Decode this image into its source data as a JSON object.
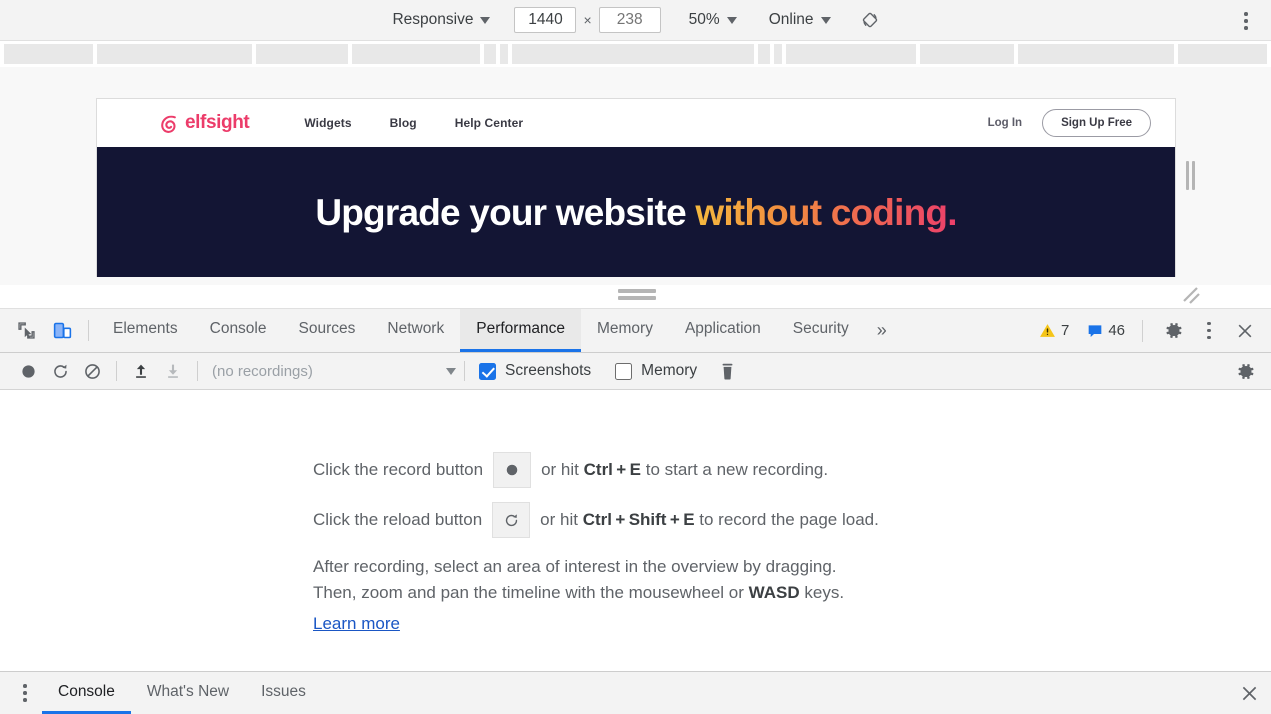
{
  "device_toolbar": {
    "device_preset": "Responsive",
    "width_value": "1440",
    "height_placeholder": "238",
    "times_symbol": "×",
    "zoom": "50%",
    "throttling": "Online",
    "rotate_icon": "rotate-icon",
    "more_options_icon": "more-vertical-icon"
  },
  "page_preview": {
    "logo_text": "elfsight",
    "nav_links": [
      "Widgets",
      "Blog",
      "Help Center"
    ],
    "login_label": "Log In",
    "signup_label": "Sign Up Free",
    "hero_text_plain": "Upgrade your website ",
    "hero_text_highlight": "without coding.",
    "colors": {
      "brand_pink": "#ec3c6a",
      "hero_bg": "#131534",
      "gradient_start": "#f5b93f",
      "gradient_end": "#ec3f6b"
    }
  },
  "devtools": {
    "inspect_icon": "inspect-cursor-icon",
    "device_toggle_icon": "device-toolbar-icon",
    "tabs": [
      {
        "label": "Elements",
        "active": false
      },
      {
        "label": "Console",
        "active": false
      },
      {
        "label": "Sources",
        "active": false
      },
      {
        "label": "Network",
        "active": false
      },
      {
        "label": "Performance",
        "active": true
      },
      {
        "label": "Memory",
        "active": false
      },
      {
        "label": "Application",
        "active": false
      },
      {
        "label": "Security",
        "active": false
      }
    ],
    "overflow_label": "»",
    "warning_count": "7",
    "warning_icon": "warning-triangle-icon",
    "message_count": "46",
    "message_icon": "message-icon",
    "settings_icon": "gear-icon",
    "more_icon": "more-vertical-icon",
    "close_icon": "close-icon"
  },
  "performance_toolbar": {
    "record_icon": "record-circle-icon",
    "reload_record_icon": "reload-icon",
    "clear_icon": "clear-prohibited-icon",
    "load_profile_icon": "upload-arrow-icon",
    "save_profile_icon": "download-arrow-icon",
    "recordings_value": "(no recordings)",
    "screenshots_label": "Screenshots",
    "screenshots_checked": true,
    "memory_label": "Memory",
    "memory_checked": false,
    "trash_icon": "trash-icon",
    "settings_icon": "gear-icon"
  },
  "landing": {
    "row1_prefix": "Click the record button",
    "row1_mid": "or hit",
    "row1_shortcut": "Ctrl + E",
    "row1_suffix": "to start a new recording.",
    "row2_prefix": "Click the reload button",
    "row2_mid": "or hit",
    "row2_shortcut": "Ctrl + Shift + E",
    "row2_suffix": "to record the page load.",
    "para_line1": "After recording, select an area of interest in the overview by dragging.",
    "para_line2_pre": "Then, zoom and pan the timeline with the mousewheel or",
    "para_line2_bold": "WASD",
    "para_line2_post": "keys.",
    "learn_more": "Learn more"
  },
  "drawer": {
    "menu_icon": "more-vertical-icon",
    "tabs": [
      {
        "label": "Console",
        "active": true
      },
      {
        "label": "What's New",
        "active": false
      },
      {
        "label": "Issues",
        "active": false
      }
    ],
    "close_icon": "close-icon"
  }
}
